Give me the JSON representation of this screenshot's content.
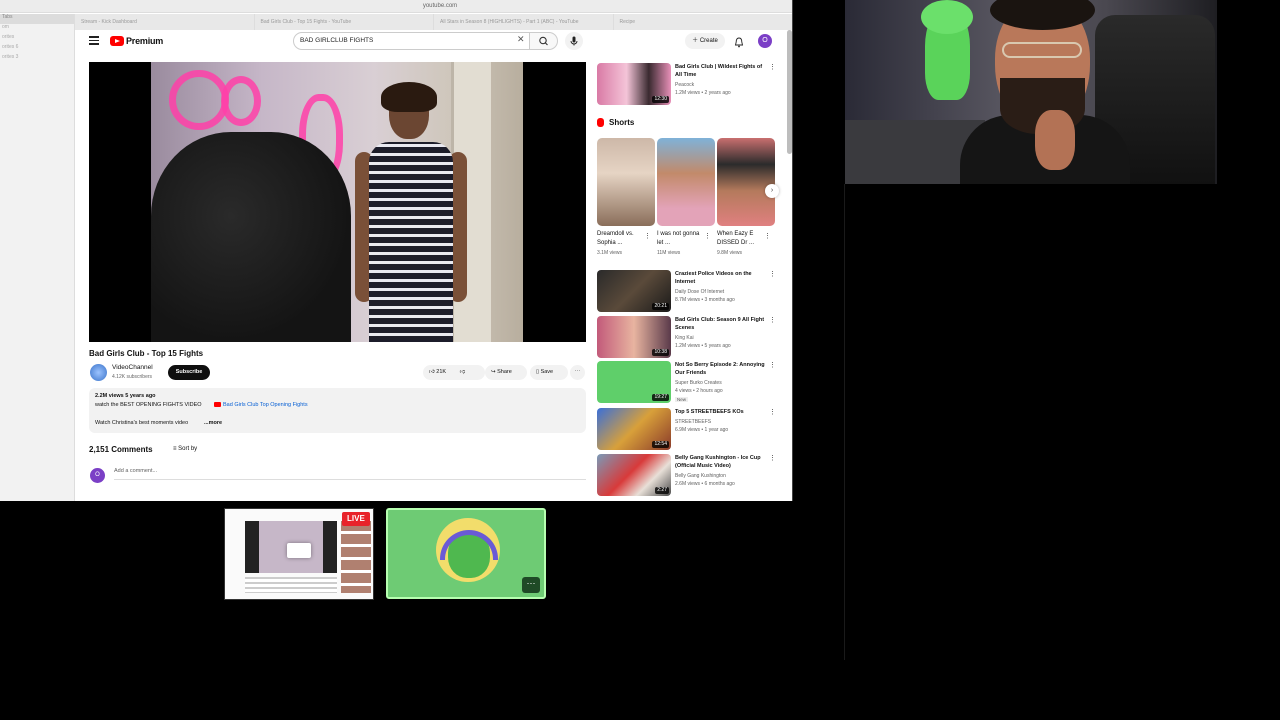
{
  "browser": {
    "url": "youtube.com",
    "tabs": [
      "Stream - Kick Dashboard",
      "Bad Girls Club - Top 15 Fights - YouTube",
      "All Stars in Season 8 (HIGHLIGHTS) - Part 1 (ABC) - YouTube",
      "Recipe"
    ],
    "sidebar_items": [
      "Tabs",
      "om",
      "orites",
      "orites 6",
      "orites 3"
    ]
  },
  "youtube": {
    "brand": "Premium",
    "search_value": "BAD GIRLCLUB FIGHTS",
    "create_label": "Create",
    "avatar_letter": "O"
  },
  "video": {
    "title": "Bad Girls Club - Top 15 Fights",
    "channel": "VideoChannel",
    "subscribers": "4.12K subscribers",
    "subscribe_label": "Subscribe",
    "likes": "21K",
    "share_label": "Share",
    "save_label": "Save",
    "views_age": "2.2M views  5 years ago",
    "desc_line1": "watch the BEST OPENING FIGHTS VIDEO",
    "desc_link": "Bad Girls Club Top Opening Fights",
    "desc_line2": "Watch Christina's best moments video",
    "desc_more": "...more",
    "comments_count": "2,151 Comments",
    "sort_label": "Sort by",
    "comment_placeholder": "Add a comment..."
  },
  "recommendations": [
    {
      "title": "Bad Girls Club | Wildest Fights of All Time",
      "channel": "Peacock",
      "meta": "1.2M views • 2 years ago",
      "duration": "12:30"
    },
    {
      "title": "Craziest Police Videos on the Internet",
      "channel": "Daily Dose Of Internet",
      "meta": "8.7M views • 3 months ago",
      "duration": "20:21"
    },
    {
      "title": "Bad Girls Club: Season 9 All Fight Scenes",
      "channel": "King Kai",
      "meta": "1.2M views • 5 years ago",
      "duration": "10:38"
    },
    {
      "title": "Not So Berry Episode 2: Annoying Our Friends",
      "channel": "Super Burko Creates",
      "meta": "4 views • 2 hours ago",
      "duration": "19:27",
      "badge": "New"
    },
    {
      "title": "Top 5 STREETBEEFS KOs",
      "channel": "STREETBEEFS",
      "meta": "6.9M views • 1 year ago",
      "duration": "12:54"
    },
    {
      "title": "Belly Gang Kushington - Ice Cup (Official Music Video)",
      "channel": "Belly Gang Kushington",
      "meta": "2.6M views • 6 months ago",
      "duration": "2:27"
    }
  ],
  "shorts": {
    "heading": "Shorts",
    "items": [
      {
        "title": "Dreamdoll vs. Sophia ...",
        "views": "3.1M views"
      },
      {
        "title": "I was not gonna let ...",
        "views": "11M views"
      },
      {
        "title": "When Eazy E DISSED Dr ...",
        "views": "9.8M views"
      }
    ]
  },
  "stream": {
    "live_label": "LIVE"
  },
  "colors": {
    "yt_red": "#ff0000",
    "live_red": "#e8232a",
    "tile_green": "#6ecb74",
    "accent_purple": "#7b3fc6"
  }
}
